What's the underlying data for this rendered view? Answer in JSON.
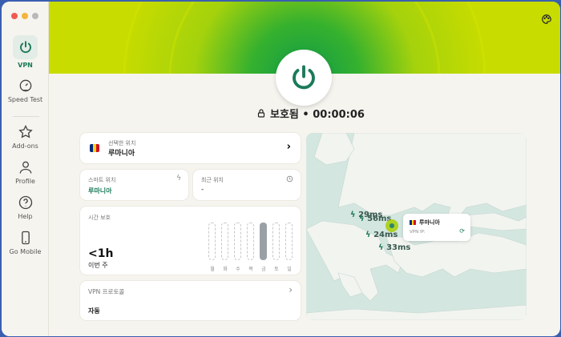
{
  "window_controls": {
    "colors": [
      "#ee5a52",
      "#f3b53a",
      "#b9b9b9"
    ]
  },
  "sidebar": {
    "items": [
      {
        "label": "VPN",
        "icon": "power-icon",
        "active": true
      },
      {
        "label": "Speed Test",
        "icon": "speedometer-icon"
      },
      {
        "label": "Add-ons",
        "icon": "star-icon"
      },
      {
        "label": "Profile",
        "icon": "person-icon"
      },
      {
        "label": "Help",
        "icon": "help-icon"
      },
      {
        "label": "Go Mobile",
        "icon": "phone-icon"
      }
    ]
  },
  "header": {
    "theme_icon": "palette-icon",
    "accent": "#1b7a5a",
    "status": "보호됨 • 00:00:06"
  },
  "location": {
    "label": "선택한 위치",
    "value": "루마니아",
    "flag": [
      "#002b7f",
      "#fcd116",
      "#ce1126"
    ]
  },
  "smart": {
    "label": "스마트 위치",
    "value": "루마니아"
  },
  "recent": {
    "label": "최근 위치",
    "value": "-"
  },
  "time": {
    "label": "시간 보호",
    "value": "<1h",
    "sub": "이번 주",
    "days": [
      "월",
      "화",
      "수",
      "목",
      "금",
      "토",
      "일"
    ],
    "active_day_index": 4
  },
  "protocol": {
    "label": "VPN 프로토콜",
    "value": "자동"
  },
  "map": {
    "latencies": [
      "29ms",
      "56ms",
      "24ms",
      "33ms"
    ],
    "popup": {
      "country": "루마니아",
      "ip_label": "VPN IP:"
    }
  }
}
